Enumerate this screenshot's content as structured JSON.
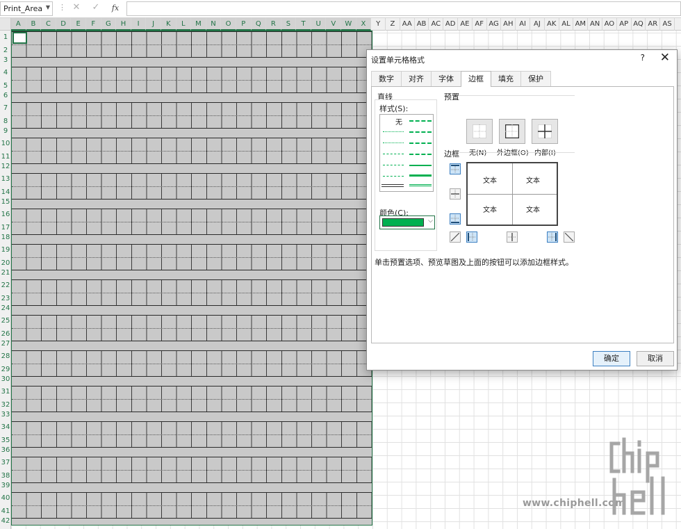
{
  "formula_bar": {
    "name_box": "Print_Area",
    "fx_label": "fx"
  },
  "columns": [
    "A",
    "B",
    "C",
    "D",
    "E",
    "F",
    "G",
    "H",
    "I",
    "J",
    "K",
    "L",
    "M",
    "N",
    "O",
    "P",
    "Q",
    "R",
    "S",
    "T",
    "U",
    "V",
    "W",
    "X",
    "Y",
    "Z",
    "AA",
    "AB",
    "AC",
    "AD",
    "AE",
    "AF",
    "AG",
    "AH",
    "AI",
    "AJ",
    "AK",
    "AL",
    "AM",
    "AN",
    "AO",
    "AP",
    "AQ",
    "AR",
    "AS"
  ],
  "rows": [
    "1",
    "2",
    "3",
    "4",
    "5",
    "6",
    "7",
    "8",
    "9",
    "10",
    "11",
    "12",
    "13",
    "14",
    "15",
    "16",
    "17",
    "18",
    "19",
    "20",
    "21",
    "22",
    "23",
    "24",
    "25",
    "26",
    "27",
    "28",
    "29",
    "30",
    "31",
    "32",
    "33",
    "34",
    "35",
    "36",
    "37",
    "38",
    "39",
    "40",
    "41",
    "42"
  ],
  "dialog": {
    "title": "设置单元格格式",
    "help": "?",
    "close": "✕",
    "tabs": [
      "数字",
      "对齐",
      "字体",
      "边框",
      "填充",
      "保护"
    ],
    "active_tab": 3,
    "line_section": "直线",
    "style_label": "样式(S):",
    "style_none": "无",
    "color_label": "颜色(C):",
    "line_color": "#00b050",
    "presets_section": "预置",
    "preset_none": "无(N)",
    "preset_outline": "外边框(O)",
    "preset_inside": "内部(I)",
    "border_section": "边框",
    "preview_text": [
      "文本",
      "文本",
      "文本",
      "文本"
    ],
    "hint": "单击预置选项、预览草图及上面的按钮可以添加边框样式。",
    "ok": "确定",
    "cancel": "取消"
  },
  "watermark": {
    "url": "www.chiphell.com",
    "logo_text": "chip hell"
  }
}
